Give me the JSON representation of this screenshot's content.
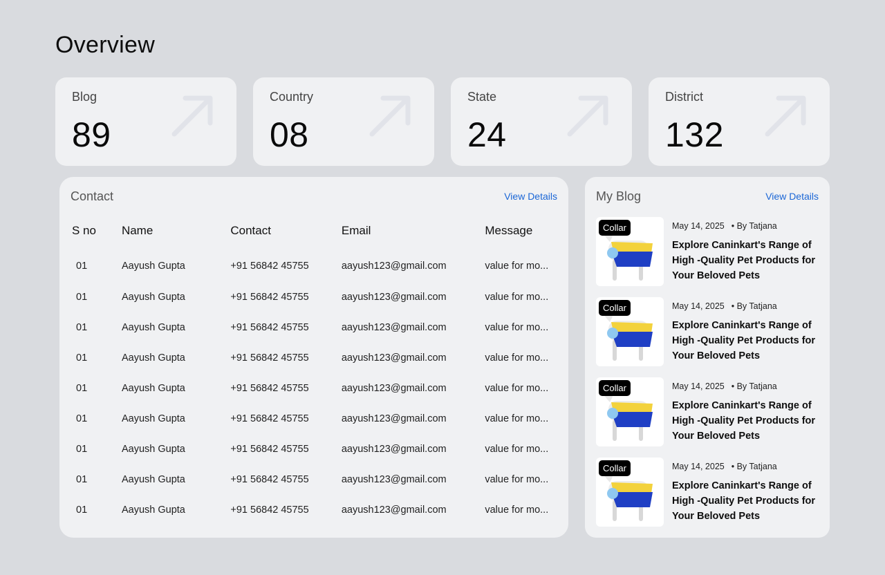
{
  "page": {
    "title": "Overview"
  },
  "stats": [
    {
      "label": "Blog",
      "value": "89",
      "icon": "arrow-up-right-icon"
    },
    {
      "label": "Country",
      "value": "08",
      "icon": "arrow-up-right-icon"
    },
    {
      "label": "State",
      "value": "24",
      "icon": "arrow-up-right-icon"
    },
    {
      "label": "District",
      "value": "132",
      "icon": "arrow-up-right-icon"
    }
  ],
  "contact": {
    "title": "Contact",
    "view_details": "View Details",
    "columns": [
      "S no",
      "Name",
      "Contact",
      "Email",
      "Message"
    ],
    "rows": [
      [
        "01",
        "Aayush Gupta",
        "+91 56842 45755",
        "aayush123@gmail.com",
        "value for mo..."
      ],
      [
        "01",
        "Aayush Gupta",
        "+91 56842 45755",
        "aayush123@gmail.com",
        "value for mo..."
      ],
      [
        "01",
        "Aayush Gupta",
        "+91 56842 45755",
        "aayush123@gmail.com",
        "value for mo..."
      ],
      [
        "01",
        "Aayush Gupta",
        "+91 56842 45755",
        "aayush123@gmail.com",
        "value for mo..."
      ],
      [
        "01",
        "Aayush Gupta",
        "+91 56842 45755",
        "aayush123@gmail.com",
        "value for mo..."
      ],
      [
        "01",
        "Aayush Gupta",
        "+91 56842 45755",
        "aayush123@gmail.com",
        "value for mo..."
      ],
      [
        "01",
        "Aayush Gupta",
        "+91 56842 45755",
        "aayush123@gmail.com",
        "value for mo..."
      ],
      [
        "01",
        "Aayush Gupta",
        "+91 56842 45755",
        "aayush123@gmail.com",
        "value for mo..."
      ],
      [
        "01",
        "Aayush Gupta",
        "+91 56842 45755",
        "aayush123@gmail.com",
        "value for mo..."
      ]
    ]
  },
  "blog": {
    "title": "My Blog",
    "view_details": "View Details",
    "posts": [
      {
        "badge": "Collar",
        "date": "May 14, 2025",
        "author": "• By Tatjana",
        "headline": "Explore Caninkart's Range of High -Quality Pet Products for Your Beloved Pets"
      },
      {
        "badge": "Collar",
        "date": "May 14, 2025",
        "author": "• By Tatjana",
        "headline": "Explore Caninkart's Range of High -Quality Pet Products for Your Beloved Pets"
      },
      {
        "badge": "Collar",
        "date": "May 14, 2025",
        "author": "• By Tatjana",
        "headline": "Explore Caninkart's Range of High -Quality Pet Products for Your Beloved Pets"
      },
      {
        "badge": "Collar",
        "date": "May 14, 2025",
        "author": "• By Tatjana",
        "headline": "Explore Caninkart's Range of High -Quality Pet Products for Your Beloved Pets"
      }
    ]
  },
  "colors": {
    "background": "#d9dbdf",
    "card": "#f0f1f3",
    "link": "#1a66d6",
    "arrow": "#e1e3e9",
    "coat_yellow": "#f3d23c",
    "coat_blue": "#1f3fc4"
  }
}
